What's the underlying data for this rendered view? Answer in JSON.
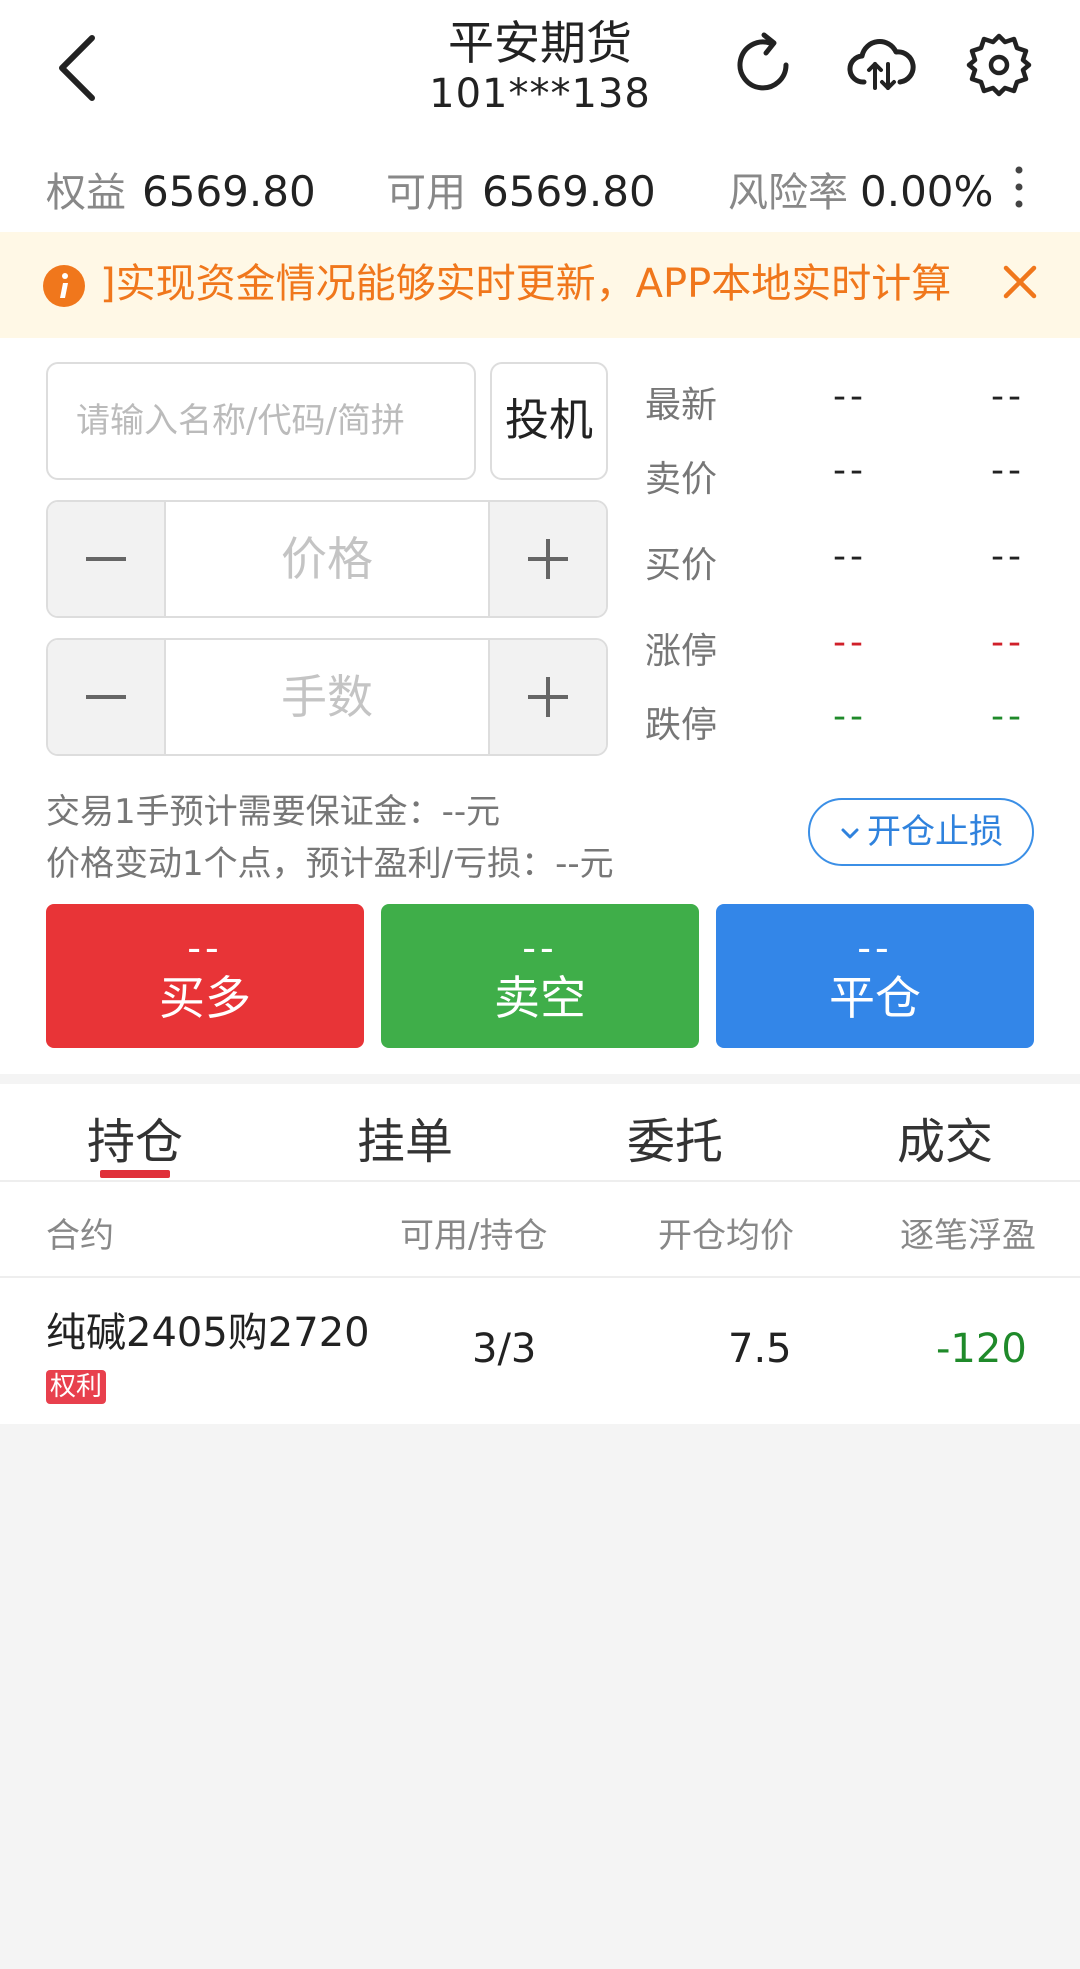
{
  "header": {
    "title": "平安期货",
    "account": "101***138",
    "icons": [
      "back-arrow-icon",
      "refresh-icon",
      "cloud-sync-icon",
      "gear-icon"
    ]
  },
  "account_bar": {
    "equity_label": "权益",
    "equity_value": "6569.80",
    "available_label": "可用",
    "available_value": "6569.80",
    "risk_label": "风险率",
    "risk_value": "0.00%"
  },
  "notice": {
    "text": "]实现资金情况能够实时更新，APP本地实时计算"
  },
  "order": {
    "search_placeholder": "请输入名称/代码/简拼",
    "type_label": "投机",
    "price_placeholder": "价格",
    "qty_placeholder": "手数",
    "margin_text": "交易1手预计需要保证金：--元",
    "pnl_text": "价格变动1个点，预计盈利/亏损：--元",
    "stoploss_label": "开仓止损"
  },
  "quote": {
    "rows": [
      {
        "label": "最新",
        "v1": "--",
        "v2": "--",
        "color": "#333333"
      },
      {
        "label": "卖价",
        "v1": "--",
        "v2": "--",
        "color": "#333333"
      },
      {
        "label": "买价",
        "v1": "--",
        "v2": "--",
        "color": "#333333"
      },
      {
        "label": "涨停",
        "v1": "--",
        "v2": "--",
        "color": "#d0202a"
      },
      {
        "label": "跌停",
        "v1": "--",
        "v2": "--",
        "color": "#1f8a2a"
      }
    ]
  },
  "trade_buttons": [
    {
      "price": "--",
      "label": "买多",
      "color": "#e83437"
    },
    {
      "price": "--",
      "label": "卖空",
      "color": "#3fae49"
    },
    {
      "price": "--",
      "label": "平仓",
      "color": "#3386e8"
    }
  ],
  "tabs": {
    "items": [
      "持仓",
      "挂单",
      "委托",
      "成交"
    ],
    "active_index": 0
  },
  "positions": {
    "columns": [
      "合约",
      "可用/持仓",
      "开仓均价",
      "逐笔浮盈"
    ],
    "rows": [
      {
        "contract": "纯碱2405购2720",
        "badge": "权利",
        "available_total": "3/3",
        "avg_price": "7.5",
        "pnl": "-120",
        "pnl_color": "#1f8a2a"
      }
    ]
  },
  "colors": {
    "accent_blue": "#3b8fe6",
    "notice_orange": "#f0771c",
    "notice_bg": "#fff8e6",
    "tab_indicator": "#e0303a"
  }
}
